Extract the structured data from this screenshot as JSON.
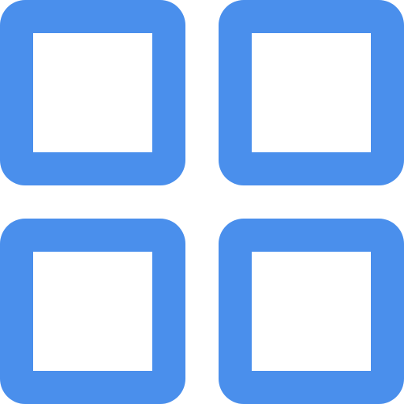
{
  "icon": {
    "name": "grid-icon",
    "accent_color": "#4a8fec",
    "background_color": "#ffffff"
  }
}
